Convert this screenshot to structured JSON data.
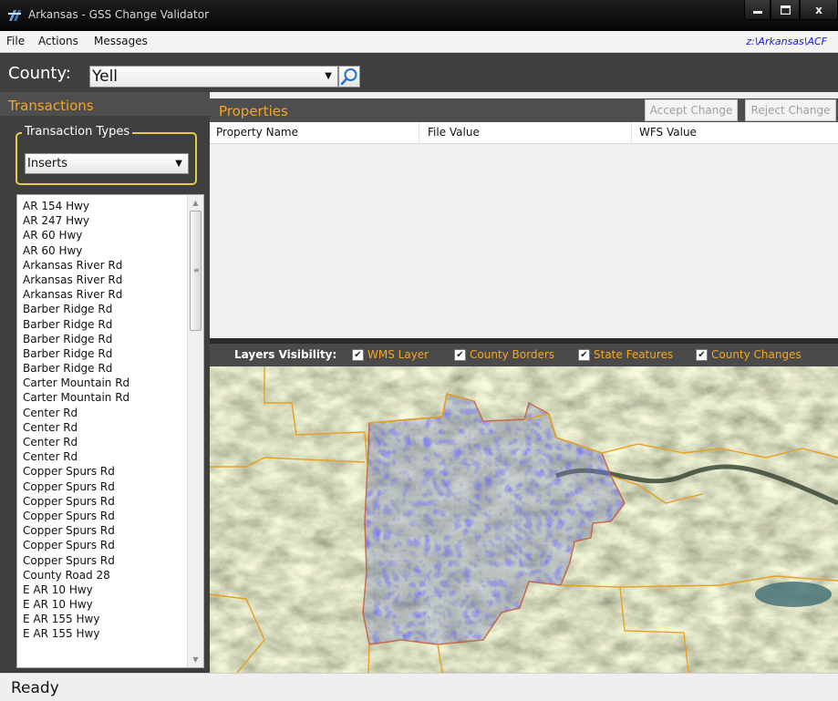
{
  "window": {
    "title": "Arkansas - GSS Change Validator",
    "controls": {
      "minimize": "‒",
      "maximize": "□",
      "close": "x"
    }
  },
  "menu": {
    "items": [
      "File",
      "Actions",
      "Messages"
    ],
    "path": "z:\\Arkansas\\ACF"
  },
  "county": {
    "label": "County:",
    "value": "Yell"
  },
  "transactions": {
    "title": "Transactions",
    "types_label": "Transaction Types",
    "type_value": "Inserts",
    "items": [
      "AR 154 Hwy",
      "AR 247 Hwy",
      "AR 60 Hwy",
      "AR 60 Hwy",
      "Arkansas River Rd",
      "Arkansas River Rd",
      "Arkansas River Rd",
      "Barber Ridge Rd",
      "Barber Ridge Rd",
      "Barber Ridge Rd",
      "Barber Ridge Rd",
      "Barber Ridge Rd",
      "Carter Mountain Rd",
      "Carter Mountain Rd",
      "Center Rd",
      "Center Rd",
      "Center Rd",
      "Center Rd",
      "Copper Spurs Rd",
      "Copper Spurs Rd",
      "Copper Spurs Rd",
      "Copper Spurs Rd",
      "Copper Spurs Rd",
      "Copper Spurs Rd",
      "Copper Spurs Rd",
      "County Road 28",
      "E AR 10 Hwy",
      "E AR 10 Hwy",
      "E AR 155 Hwy",
      "E AR 155 Hwy"
    ]
  },
  "properties": {
    "title": "Properties",
    "accept_label": "Accept Change",
    "reject_label": "Reject Change",
    "columns": [
      "Property Name",
      "File Value",
      "WFS Value"
    ]
  },
  "layers": {
    "label": "Layers Visibility:",
    "items": [
      {
        "label": "WMS Layer",
        "checked": true
      },
      {
        "label": "County Borders",
        "checked": true
      },
      {
        "label": "State Features",
        "checked": true
      },
      {
        "label": "County Changes",
        "checked": true
      }
    ],
    "check_glyph": "✔"
  },
  "colors": {
    "accent_orange": "#f5a623",
    "county_border": "#e8a020",
    "changes_blue": "#2a2aff",
    "path_link": "#1a1ad0"
  },
  "status": "Ready"
}
